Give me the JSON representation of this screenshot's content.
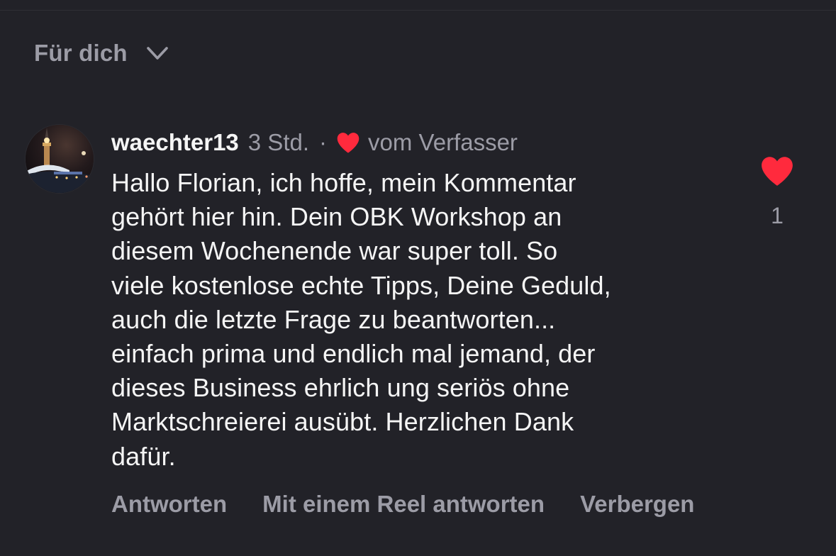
{
  "sort": {
    "label": "Für dich",
    "icon": "chevron-down-icon"
  },
  "comment": {
    "username": "waechter13",
    "timestamp": "3 Std.",
    "separator": "·",
    "author_like_icon": "heart-icon",
    "author_like_label": "vom Verfasser",
    "text": "Hallo Florian, ich hoffe, mein Kommentar\ngehört hier hin. Dein OBK Workshop an\ndiesem Wochenende war  super toll. So\nviele kostenlose echte Tipps, Deine Geduld,\nauch die letzte Frage zu beantworten...\neinfach prima und endlich mal jemand, der\ndieses Business ehrlich ung seriös  ohne\nMarktschreierei ausübt. Herzlichen Dank\ndafür.",
    "like_icon": "heart-icon",
    "like_count": "1",
    "liked": true
  },
  "actions": {
    "reply": "Antworten",
    "reel_reply": "Mit einem Reel antworten",
    "hide": "Verbergen"
  },
  "colors": {
    "background": "#222228",
    "primary_text": "#f5f5f5",
    "secondary_text": "#9c9ca6",
    "heart": "#ff2a3d"
  }
}
